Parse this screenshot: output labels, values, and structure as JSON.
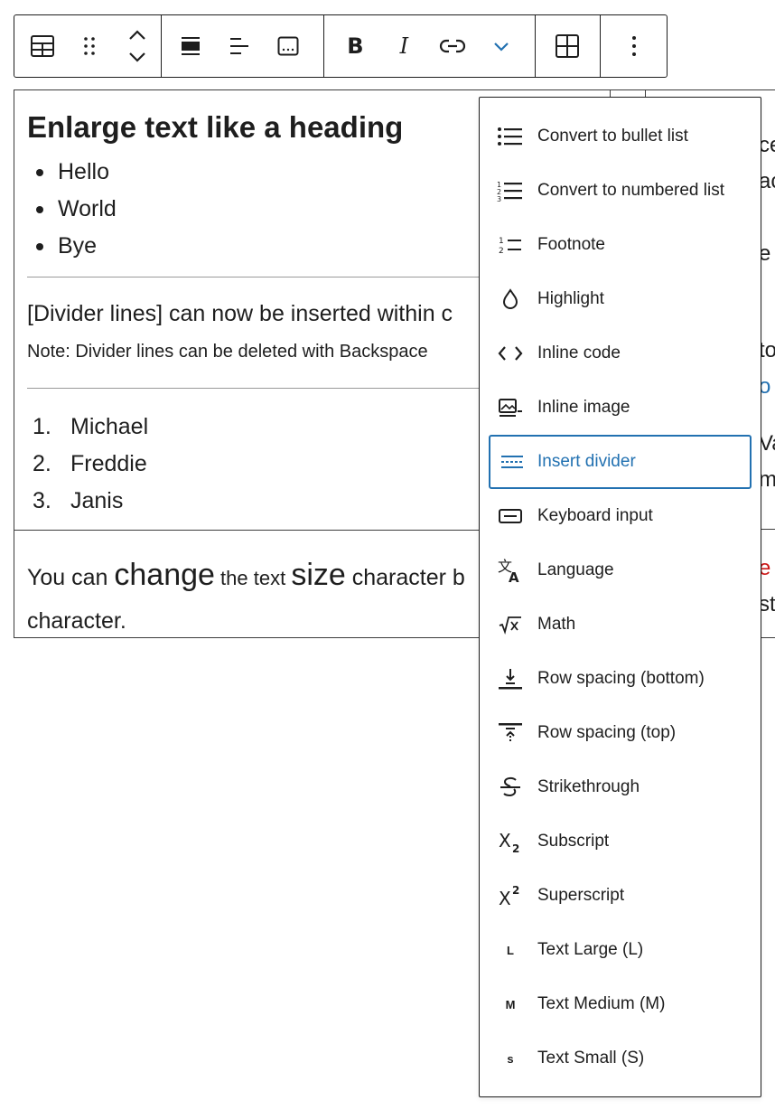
{
  "toolbar": {
    "buttons": [
      "table-icon",
      "drag-handle-icon",
      "move-up-down-icon",
      "align-wide-icon",
      "align-left-icon",
      "caption-icon",
      "bold-icon",
      "italic-icon",
      "link-icon",
      "more-rich-text-icon",
      "insert-table-icon",
      "options-icon"
    ]
  },
  "content": {
    "heading": "Enlarge text like a heading",
    "bullets": [
      "Hello",
      "World",
      "Bye"
    ],
    "divider_para": "[Divider lines] can now be inserted within c",
    "note": "Note: Divider lines can be deleted with Backspace",
    "numbered": [
      {
        "num": "1.",
        "text": "Michael"
      },
      {
        "num": "2.",
        "text": "Freddie"
      },
      {
        "num": "3.",
        "text": "Janis"
      }
    ],
    "size_para": {
      "a": "You can ",
      "b": "change",
      "c": " the text ",
      "d": "size",
      "e": " character b",
      "line2": "character."
    },
    "right_fragments": [
      "ce",
      "ac",
      "e",
      "to",
      "o (",
      "Va",
      "m",
      "e",
      "st"
    ]
  },
  "menu": {
    "items": [
      {
        "label": "Convert to bullet list",
        "icon": "bullet-list-icon"
      },
      {
        "label": "Convert to numbered list",
        "icon": "numbered-list-icon"
      },
      {
        "label": "Footnote",
        "icon": "footnote-icon"
      },
      {
        "label": "Highlight",
        "icon": "highlight-icon"
      },
      {
        "label": "Inline code",
        "icon": "code-icon"
      },
      {
        "label": "Inline image",
        "icon": "image-icon"
      },
      {
        "label": "Insert divider",
        "icon": "divider-icon",
        "active": true
      },
      {
        "label": "Keyboard input",
        "icon": "keyboard-icon"
      },
      {
        "label": "Language",
        "icon": "language-icon"
      },
      {
        "label": "Math",
        "icon": "math-icon"
      },
      {
        "label": "Row spacing (bottom)",
        "icon": "row-spacing-bottom-icon"
      },
      {
        "label": "Row spacing (top)",
        "icon": "row-spacing-top-icon"
      },
      {
        "label": "Strikethrough",
        "icon": "strikethrough-icon"
      },
      {
        "label": "Subscript",
        "icon": "subscript-icon"
      },
      {
        "label": "Superscript",
        "icon": "superscript-icon"
      },
      {
        "label": "Text Large (L)",
        "icon": "L"
      },
      {
        "label": "Text Medium (M)",
        "icon": "M"
      },
      {
        "label": "Text Small (S)",
        "icon": "S"
      }
    ]
  },
  "colors": {
    "accent": "#2271b1",
    "text": "#1e1e1e",
    "red": "#cc1818"
  }
}
